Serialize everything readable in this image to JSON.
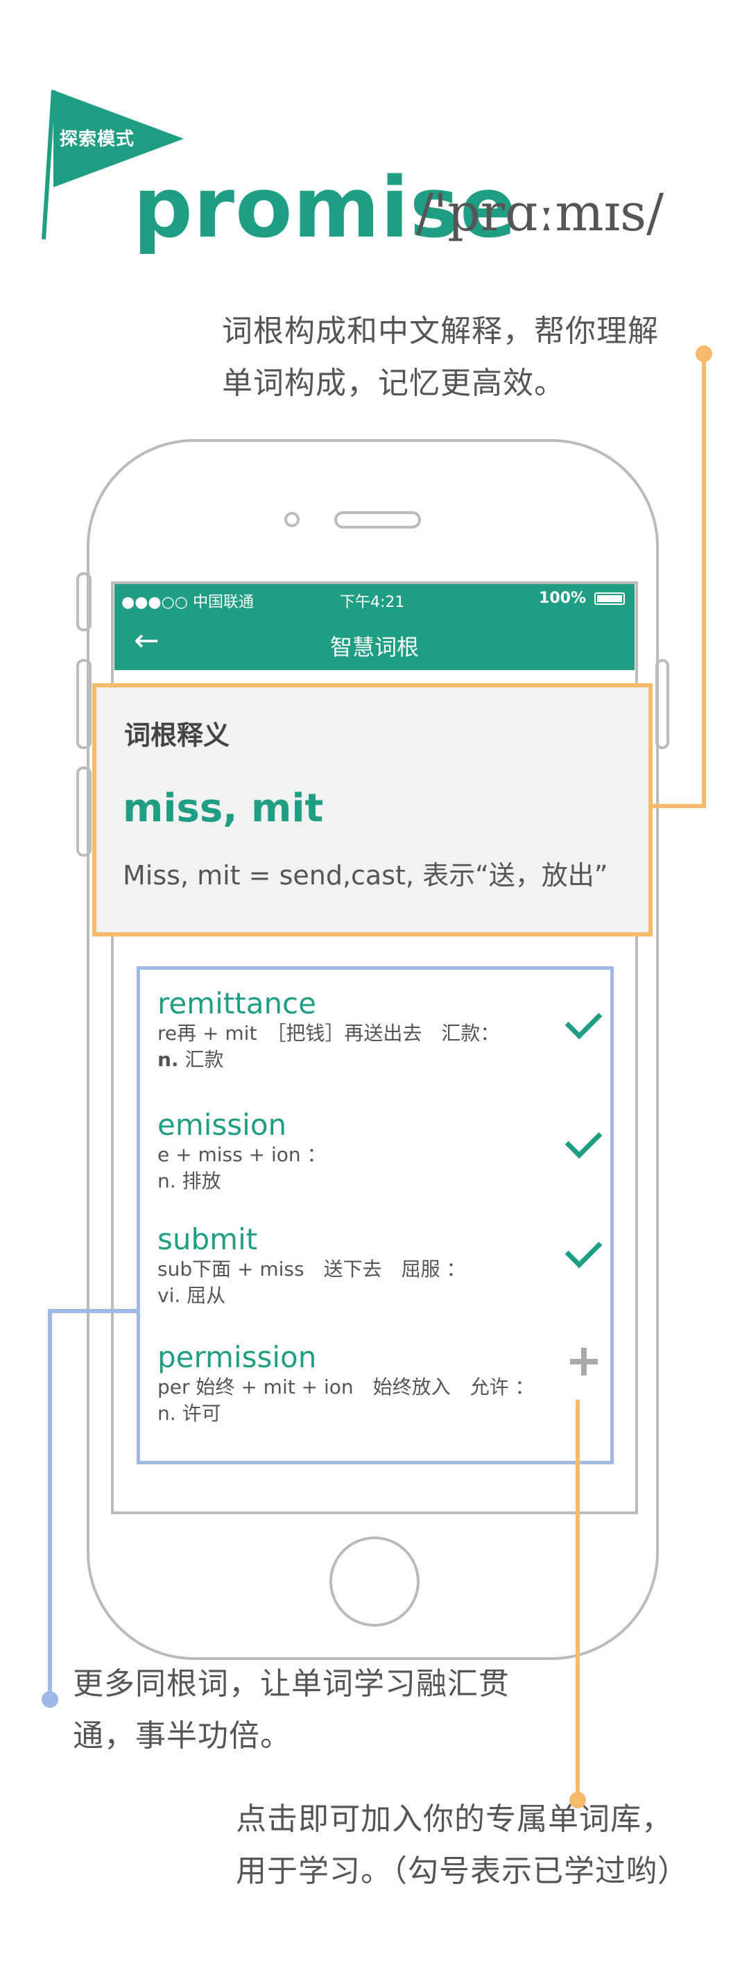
{
  "header": {
    "mode_label": "探索模式",
    "word": "promise",
    "phonetic": "/'prɑːmɪs/"
  },
  "callouts": {
    "top": [
      "词根构成和中文解释，帮你理解",
      "单词构成，记忆更高效。"
    ],
    "left": [
      "更多同根词，让单词学习融汇贯",
      "通，事半功倍。"
    ],
    "bottom": [
      "点击即可加入你的专属单词库，",
      "用于学习。（勾号表示已学过哟）"
    ]
  },
  "status_bar": {
    "carrier": "●●●○○ 中国联通",
    "time": "下午4:21",
    "battery": "100%"
  },
  "nav": {
    "back": "←",
    "title": "智慧词根"
  },
  "root": {
    "heading": "词根释义",
    "name": "miss, mit",
    "definition": "Miss, mit = send,cast, 表示“送，放出”"
  },
  "words": [
    {
      "term": "remittance",
      "parts": "re再 + mit　［把钱］再送出去　汇款：",
      "pos": "n.",
      "meaning": "汇款",
      "status": "learned"
    },
    {
      "term": "emission",
      "parts": "e + miss + ion ：",
      "pos": "n.",
      "meaning": "排放",
      "status": "learned"
    },
    {
      "term": "submit",
      "parts": "sub下面 + miss　送下去　屈服 ：",
      "pos": "vi.",
      "meaning": "屈从",
      "status": "learned"
    },
    {
      "term": "permission",
      "parts": "per 始终 + mit + ion　始终放入　允许 ：",
      "pos": "n.",
      "meaning": "许可",
      "status": "add"
    }
  ],
  "colors": {
    "brand_green": "#1f9e84",
    "orange_accent": "#f7b96b",
    "blue_accent": "#9fb8e6",
    "phone_outline": "#bbbbbb"
  }
}
